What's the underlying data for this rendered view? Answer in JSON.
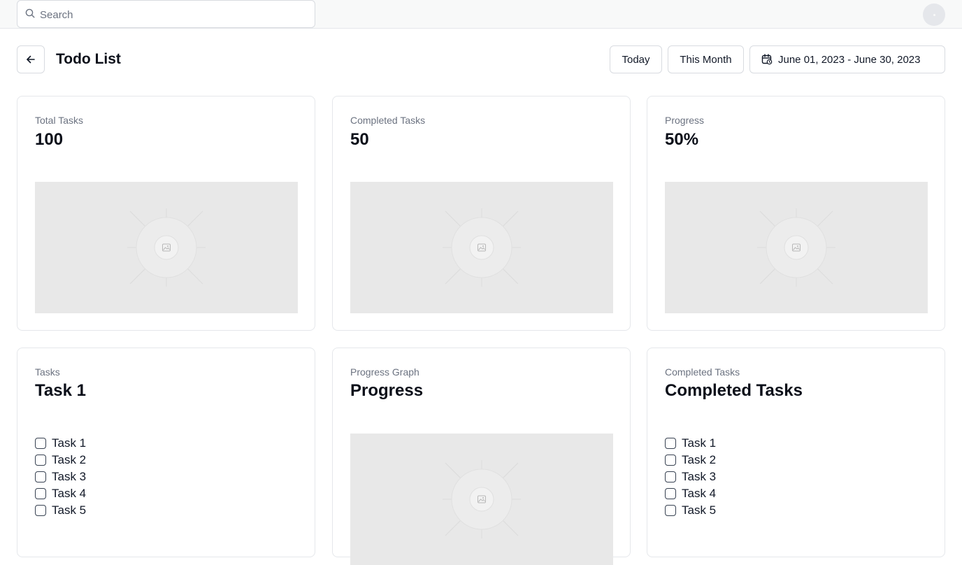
{
  "search": {
    "placeholder": "Search",
    "icon": "search-icon"
  },
  "header": {
    "title": "Todo List",
    "back_icon": "arrow-left-icon",
    "today_label": "Today",
    "this_month_label": "This Month",
    "date_range_label": "June 01, 2023 - June 30, 2023",
    "date_range_icon": "calendar-icon"
  },
  "cards_top": [
    {
      "label": "Total Tasks",
      "value": "100"
    },
    {
      "label": "Completed Tasks",
      "value": "50"
    },
    {
      "label": "Progress",
      "value": "50%"
    }
  ],
  "cards_bottom": {
    "tasks": {
      "label": "Tasks",
      "heading": "Task 1",
      "items": [
        "Task 1",
        "Task 2",
        "Task 3",
        "Task 4",
        "Task 5"
      ]
    },
    "progress_graph": {
      "label": "Progress Graph",
      "heading": "Progress"
    },
    "completed": {
      "label": "Completed Tasks",
      "heading": "Completed Tasks",
      "items": [
        "Task 1",
        "Task 2",
        "Task 3",
        "Task 4",
        "Task 5"
      ]
    }
  },
  "colors": {
    "border": "#e5e7eb",
    "placeholder_bg": "#e8e8e8",
    "muted_text": "#6b7280",
    "text": "#0b0f19"
  }
}
